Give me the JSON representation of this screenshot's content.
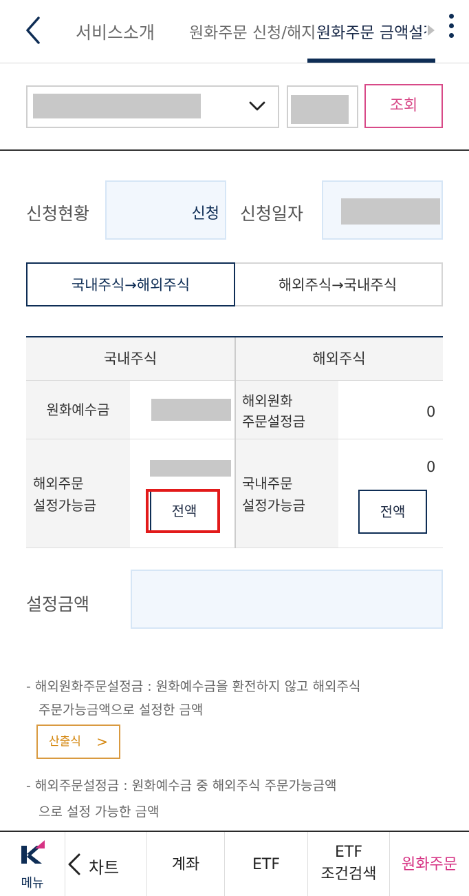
{
  "header": {
    "tabs": [
      "서비스소개",
      "원화주문 신청/해지",
      "원화주문 금액설정"
    ],
    "active_tab_index": 2,
    "accent": "#0e2d55"
  },
  "search": {
    "query_label": "조회",
    "query_color": "#d84a88"
  },
  "status": {
    "status_label": "신청현황",
    "status_value": "신청",
    "date_label": "신청일자"
  },
  "toggle": {
    "domestic_to_foreign": "국내주식→해외주식",
    "foreign_to_domestic": "해외주식→국내주식"
  },
  "table": {
    "col_domestic": "국내주식",
    "col_foreign": "해외주식",
    "krw_deposit_label": "원화예수금",
    "foreign_order_setting_label_1": "해외원화",
    "foreign_order_setting_label_2": "주문설정금",
    "foreign_order_setting_value": "0",
    "foreign_available_label_1": "해외주문",
    "foreign_available_label_2": "설정가능금",
    "domestic_available_label_1": "국내주문",
    "domestic_available_label_2": "설정가능금",
    "domestic_available_value": "0",
    "all_button_label": "전액"
  },
  "amount": {
    "label": "설정금액"
  },
  "notes": {
    "note1_line1": "- 해외원화주문설정금 : 원화예수금을 환전하지 않고 해외주식",
    "note1_line2": "주문가능금액으로 설정한 금액",
    "calc_button": "산출식",
    "calc_arrow": ">",
    "note2_line1": "- 해외주문설정금 : 원화예수금 중 해외주식 주문가능금액",
    "note2_line2": "으로 설정 가능한 금액"
  },
  "bottom_nav": {
    "menu_logo": "K",
    "menu_label": "메뉴",
    "items": [
      "차트",
      "계좌",
      "ETF",
      "ETF",
      "조건검색",
      "원화주문"
    ],
    "active_color": "#d63384"
  }
}
